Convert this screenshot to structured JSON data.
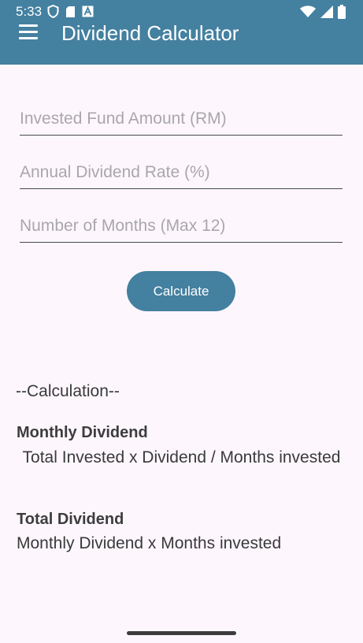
{
  "status_bar": {
    "time": "5:33",
    "left_icons": [
      "shield-icon",
      "sd-card-icon",
      "font-a-icon"
    ],
    "right_icons": [
      "wifi-icon",
      "signal-icon",
      "battery-icon"
    ]
  },
  "app_bar": {
    "title": "Dividend Calculator",
    "menu_icon": "menu-icon",
    "color": "#4480a0"
  },
  "form": {
    "fund_placeholder": "Invested Fund Amount (RM)",
    "rate_placeholder": "Annual Dividend Rate (%)",
    "months_placeholder": "Number of Months (Max 12)",
    "button_label": "Calculate"
  },
  "calculation": {
    "header": "--Calculation--",
    "monthly_title": "Monthly Dividend",
    "monthly_formula": "Total Invested x Dividend / Months invested",
    "total_title": "Total Dividend",
    "total_formula": "Monthly Dividend x Months invested"
  }
}
